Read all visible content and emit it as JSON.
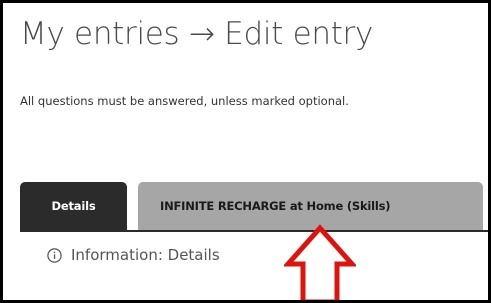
{
  "header": {
    "title": "My entries → Edit entry"
  },
  "instructions": "All questions must be answered, unless marked optional.",
  "tabs": [
    {
      "label": "Details",
      "active": true
    },
    {
      "label": "INFINITE RECHARGE at Home (Skills)",
      "active": false
    }
  ],
  "info": {
    "icon": "info-circle-icon",
    "label": "Information: Details"
  },
  "annotation": {
    "icon": "red-arrow-up-icon",
    "color": "#e0120c"
  },
  "colors": {
    "active_tab": "#2b2b2b",
    "inactive_tab": "#a6a6a6",
    "title": "#4a4a4a"
  }
}
